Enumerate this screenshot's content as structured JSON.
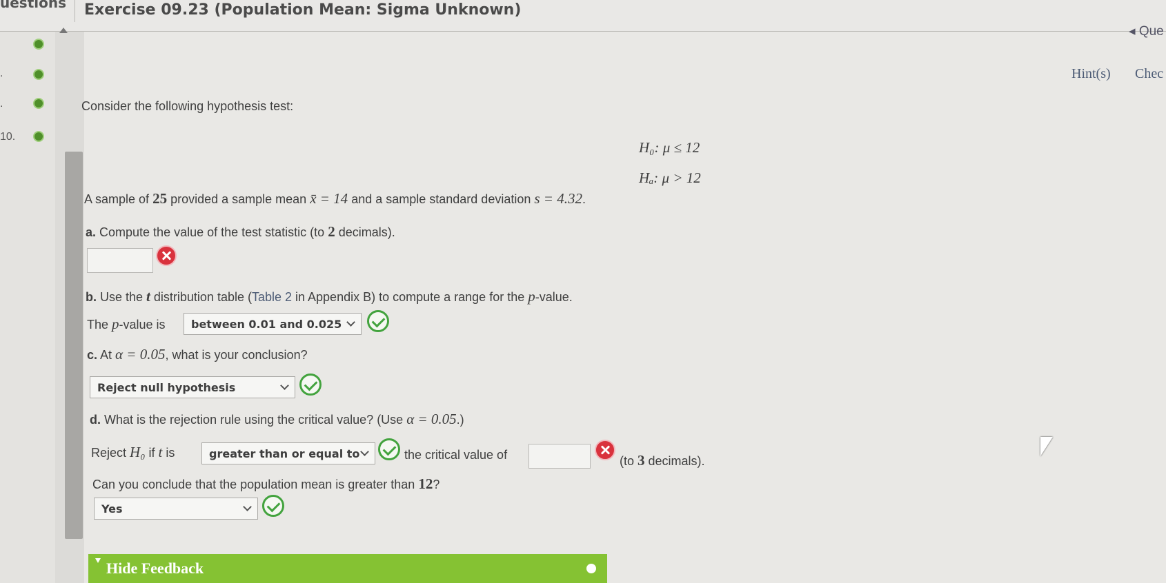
{
  "header": {
    "questions_label": "uestions",
    "title": "Exercise 09.23 (Population Mean: Sigma Unknown)"
  },
  "sidebar": {
    "items": [
      {
        "num": "",
        "status": "complete"
      },
      {
        "num": ".",
        "status": "complete"
      },
      {
        "num": ".",
        "status": "complete"
      },
      {
        "num": "10.",
        "status": "complete"
      }
    ]
  },
  "toolbar": {
    "questions_link": "◂ Que",
    "hints": "Hint(s)",
    "check": "Chec"
  },
  "problem": {
    "intro": "Consider the following hypothesis test:",
    "h0": "H₀: μ ≤ 12",
    "ha": "Hₐ: μ > 12",
    "sample_text_1": "A sample of ",
    "n": "25",
    "sample_text_2": " provided a sample mean ",
    "xbar_eq": "x̄ = 14",
    "sample_text_3": " and a sample standard deviation ",
    "s_eq": "s = 4.32",
    "sample_text_4": "."
  },
  "part_a": {
    "prefix": "a.",
    "text_1": " Compute the value of the test statistic (to ",
    "decimals": "2",
    "text_2": " decimals).",
    "answer": "",
    "result": "incorrect"
  },
  "part_b": {
    "prefix": "b.",
    "text_1": " Use the ",
    "t": "t",
    "text_2": " distribution table (",
    "table_link": "Table 2",
    "text_3": " in Appendix B) to compute a range for the ",
    "p": "p",
    "text_4": "-value.",
    "line2_1": "The ",
    "line2_p": "p",
    "line2_2": "-value is",
    "selected": "between 0.01 and 0.025",
    "result": "correct"
  },
  "part_c": {
    "prefix": "c.",
    "text_1": " At ",
    "alpha_eq": "α = 0.05",
    "text_2": ", what is your conclusion?",
    "selected": "Reject null hypothesis",
    "result": "correct"
  },
  "part_d": {
    "prefix": "d.",
    "text_1": " What is the rejection rule using the critical value? (Use ",
    "alpha_eq": "α = 0.05",
    "text_2": ".)",
    "rule_1": "Reject ",
    "h0": "H₀",
    "rule_2": " if ",
    "t": "t",
    "rule_3": " is",
    "selected": "greater than or equal to",
    "select_result": "correct",
    "rule_4": "the critical value of",
    "critical_value": "",
    "critical_result": "incorrect",
    "rule_5a": "(to ",
    "rule_5b": "3",
    "rule_5c": " decimals).",
    "conclude_1": "Can you conclude that the population mean is greater than ",
    "conclude_num": "12",
    "conclude_2": "?",
    "conclude_selected": "Yes",
    "conclude_result": "correct"
  },
  "feedback": {
    "label": "Hide Feedback"
  },
  "colors": {
    "correct": "#43a33e",
    "incorrect": "#d9323d",
    "feedback_bar": "#85c233",
    "link": "#4c5b75"
  }
}
